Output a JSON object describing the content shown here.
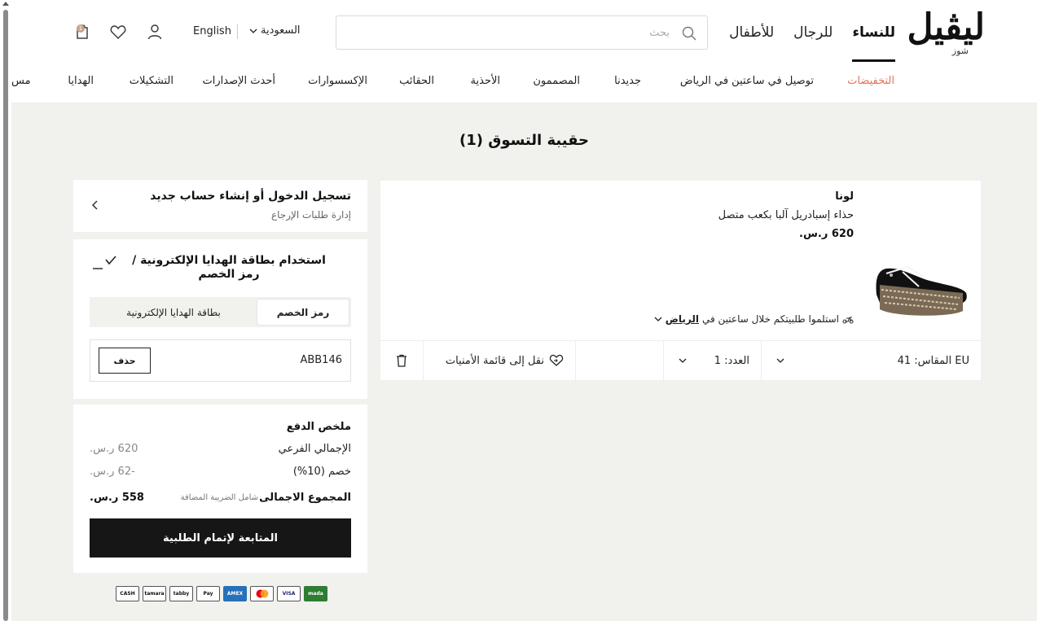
{
  "brand": {
    "logo_text": "ليڤيل",
    "logo_sub": "شوز"
  },
  "header": {
    "gender_tabs": [
      {
        "label": "للنساء",
        "active": true
      },
      {
        "label": "للرجال",
        "active": false
      },
      {
        "label": "للأطفال",
        "active": false
      }
    ],
    "search_placeholder": "بحث",
    "region": "السعودية",
    "language": "English",
    "cart_count": "1",
    "icons": [
      "user-icon",
      "heart-icon",
      "bag-icon",
      "search-icon"
    ]
  },
  "categories": [
    {
      "label": "التخفيضات",
      "sale": true
    },
    {
      "label": "توصيل في ساعتين في الرياض"
    },
    {
      "label": "جديدنا"
    },
    {
      "label": "المصممون"
    },
    {
      "label": "الأحذية"
    },
    {
      "label": "الحقائب"
    },
    {
      "label": "الإكسسوارات"
    },
    {
      "label": "أحدث الإصدارات"
    },
    {
      "label": "التشكيلات"
    },
    {
      "label": "الهدايا"
    },
    {
      "label": "مس"
    }
  ],
  "page": {
    "title": "حقيبة التسوق (1)"
  },
  "cart_item": {
    "brand": "لونا",
    "name": "حذاء إسبادريل آلبا بكعب متصل",
    "price": "620 ر.س.",
    "delivery_text": "استلموا طلبيتكم خلال ساعتين في",
    "delivery_city": "الرياض",
    "size": "المقاس: 41 EU",
    "quantity": "العدد: 1",
    "move_to_wishlist": "نقل إلى قائمة الأمنيات"
  },
  "login": {
    "title": "تسجيل الدخول أو إنشاء حساب جديد",
    "subtitle": "إدارة طلبات الإرجاع"
  },
  "promo": {
    "title": "استخدام بطاقة الهدايا الإلكترونية / رمز الخصم",
    "tabs": [
      {
        "label": "رمز الخصم",
        "active": true
      },
      {
        "label": "بطاقة الهدايا الإلكترونية",
        "active": false
      }
    ],
    "applied_code": "ABB146",
    "remove_label": "حذف"
  },
  "summary": {
    "title": "ملخص الدفع",
    "subtotal_label": "الإجمالي الفرعي",
    "subtotal_value": "620 ر.س.",
    "discount_label": "خصم (10%)",
    "discount_value": "-62 ر.س.",
    "total_label": "المجموع الاجمالى",
    "tax_note": "شامل الضريبة المضافة",
    "total_value": "558 ر.س.",
    "checkout_label": "المتابعة لإتمام الطلبية"
  },
  "payment_methods": [
    "CASH",
    "tamara",
    "tabby",
    "Pay",
    "AMEX",
    "mc",
    "VISA",
    "mada"
  ],
  "colors": {
    "sale": "#e0735b",
    "page_bg": "#f1f1ee",
    "button": "#161616",
    "amex": "#2671b9",
    "mada": "#2e7d32",
    "badge": "#c9a38a"
  }
}
